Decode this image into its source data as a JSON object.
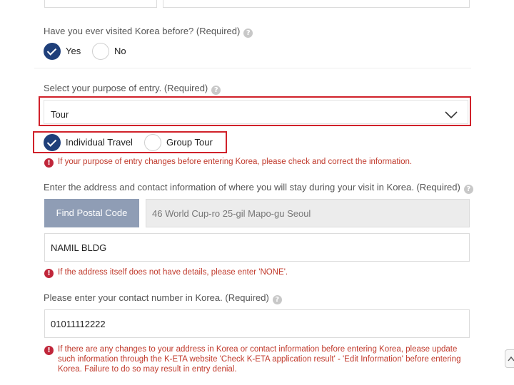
{
  "visited": {
    "question": "Have you ever visited Korea before? (Required)",
    "help_icon": "question-icon",
    "options": [
      "Yes",
      "No"
    ],
    "selected": "Yes"
  },
  "purpose": {
    "question": "Select your purpose of entry. (Required)",
    "help_icon": "question-icon",
    "selected_value": "Tour",
    "chevron_icon": "chevron-down-icon",
    "sub_options": [
      "Individual Travel",
      "Group Tour"
    ],
    "sub_selected": "Individual Travel",
    "notice": "If your purpose of entry changes before entering Korea, please check and correct the information."
  },
  "address": {
    "question": "Enter the address and contact information of where you will stay during your visit in Korea. (Required)",
    "help_icon": "question-icon",
    "find_postal_button": "Find Postal Code",
    "address_value": "46 World Cup-ro 25-gil Mapo-gu Seoul",
    "detail_value": "NAMIL BLDG",
    "notice": "If the address itself does not have details, please enter 'NONE'."
  },
  "contact": {
    "question": "Please enter your contact number in Korea. (Required)",
    "help_icon": "question-icon",
    "phone_value": "01011112222",
    "notice": "If there are any changes to your address in Korea or contact information before entering Korea, please update such information through the K-ETA website 'Check K-ETA application result' - 'Edit Information' before entering Korea. Failure to do so may result in entry denial."
  },
  "colors": {
    "accent": "#1f3f7a",
    "highlight_frame": "#d0212a",
    "notice_text": "#c0392b",
    "button": "#8f9db5"
  },
  "scroll_top_icon": "chevron-up-icon"
}
